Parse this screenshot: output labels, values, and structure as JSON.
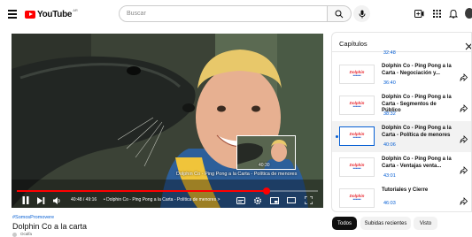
{
  "header": {
    "menu_icon": "hamburger-menu-icon",
    "logo_text": "YouTube",
    "logo_country": "AR",
    "search_placeholder": "Buscar",
    "search_icon": "search-icon",
    "mic_icon": "microphone-icon",
    "create_icon": "create-video-icon",
    "apps_icon": "apps-grid-icon",
    "notifications_icon": "bell-icon",
    "colors": {
      "brand": "#ff0000"
    }
  },
  "player": {
    "overlay_title": "Dolphin Co - Ping Pong a la Carta - Política de menores",
    "preview_time": "40:30",
    "time_display": "40:48 / 49:16",
    "chapter_display": "• Dolphin Co - Ping Pong a la Carta - Política de menores >",
    "progress_fraction": 0.83,
    "colors": {
      "progress": "#ff0000"
    }
  },
  "video": {
    "hashtag": "#SomosPromovere",
    "title": "Dolphin Co a la carta",
    "channel": "Ocalfa"
  },
  "chapters_panel": {
    "title": "Capítulos",
    "close_icon": "close-icon",
    "top_time": "32:48",
    "items": [
      {
        "title": "Dolphin Co - Ping Pong a la Carta - Negociación y...",
        "time": "36:40",
        "thumb_logo": "Dolphin",
        "active": false
      },
      {
        "title": "Dolphin Co - Ping Pong a la Carta - Segmentos de Público",
        "time": "38:32",
        "thumb_logo": "Dolphin",
        "active": false
      },
      {
        "title": "Dolphin Co - Ping Pong a la Carta - Política de menores",
        "time": "40:06",
        "thumb_logo": "Dolphin",
        "active": true
      },
      {
        "title": "Dolphin Co - Ping Pong a la Carta - Ventajas venta...",
        "time": "43:01",
        "thumb_logo": "Dolphin",
        "active": false
      },
      {
        "title": "Tutoriales y Cierre",
        "time": "46:03",
        "thumb_logo": "Dolphin",
        "active": false
      }
    ]
  },
  "chips": [
    {
      "label": "Todos",
      "active": true
    },
    {
      "label": "Subidas recientes",
      "active": false
    },
    {
      "label": "Visto",
      "active": false
    }
  ]
}
